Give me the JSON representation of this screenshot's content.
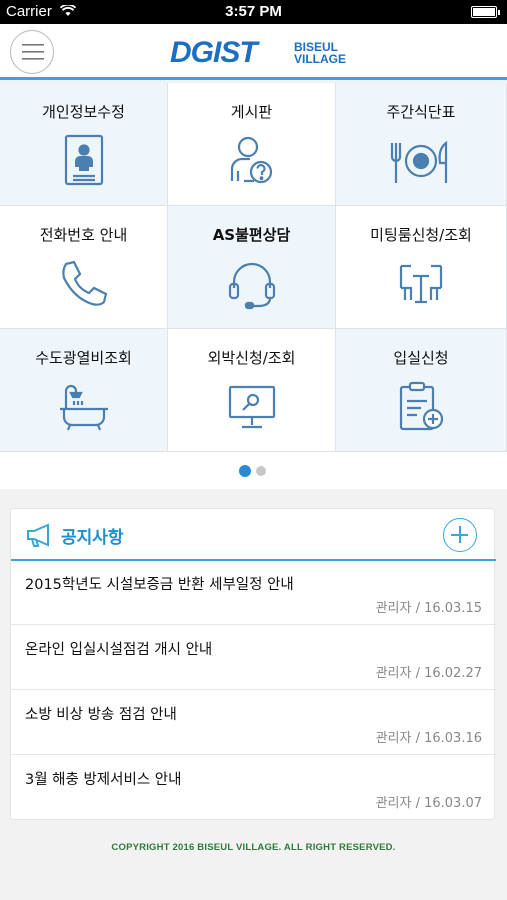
{
  "status_bar": {
    "carrier": "Carrier",
    "time": "3:57 PM",
    "battery_level": 1.0
  },
  "header": {
    "logo_text": "DGIST",
    "logo_sub_1": "BISEUL",
    "logo_sub_2": "VILLAGE"
  },
  "menu": [
    {
      "label": "개인정보수정",
      "icon": "profile-card-icon"
    },
    {
      "label": "게시판",
      "icon": "board-help-icon"
    },
    {
      "label": "주간식단표",
      "icon": "meal-icon"
    },
    {
      "label": "전화번호 안내",
      "icon": "phone-icon"
    },
    {
      "label": "AS불편상담",
      "icon": "headset-icon"
    },
    {
      "label": "미팅룸신청/조회",
      "icon": "meeting-table-icon"
    },
    {
      "label": "수도광열비조회",
      "icon": "bathtub-icon"
    },
    {
      "label": "외박신청/조회",
      "icon": "monitor-search-icon"
    },
    {
      "label": "입실신청",
      "icon": "clipboard-add-icon"
    }
  ],
  "pager": {
    "pages": 2,
    "current": 1
  },
  "notice": {
    "title": "공지사항",
    "items": [
      {
        "title": "2015학년도 시설보증금 반환 세부일정 안내",
        "meta": "관리자 / 16.03.15"
      },
      {
        "title": "온라인 입실시설점검 개시 안내",
        "meta": "관리자 / 16.02.27"
      },
      {
        "title": "소방 비상 방송 점검 안내",
        "meta": "관리자 / 16.03.16"
      },
      {
        "title": "3월 해충 방제서비스 안내",
        "meta": "관리자 / 16.03.07"
      }
    ]
  },
  "footer": {
    "copyright": "COPYRIGHT 2016 BISEUL VILLAGE. ALL RIGHT RESERVED."
  },
  "colors": {
    "accent": "#3aa6d8",
    "icon": "#4a7fb0",
    "brand": "#1b6ec2"
  }
}
